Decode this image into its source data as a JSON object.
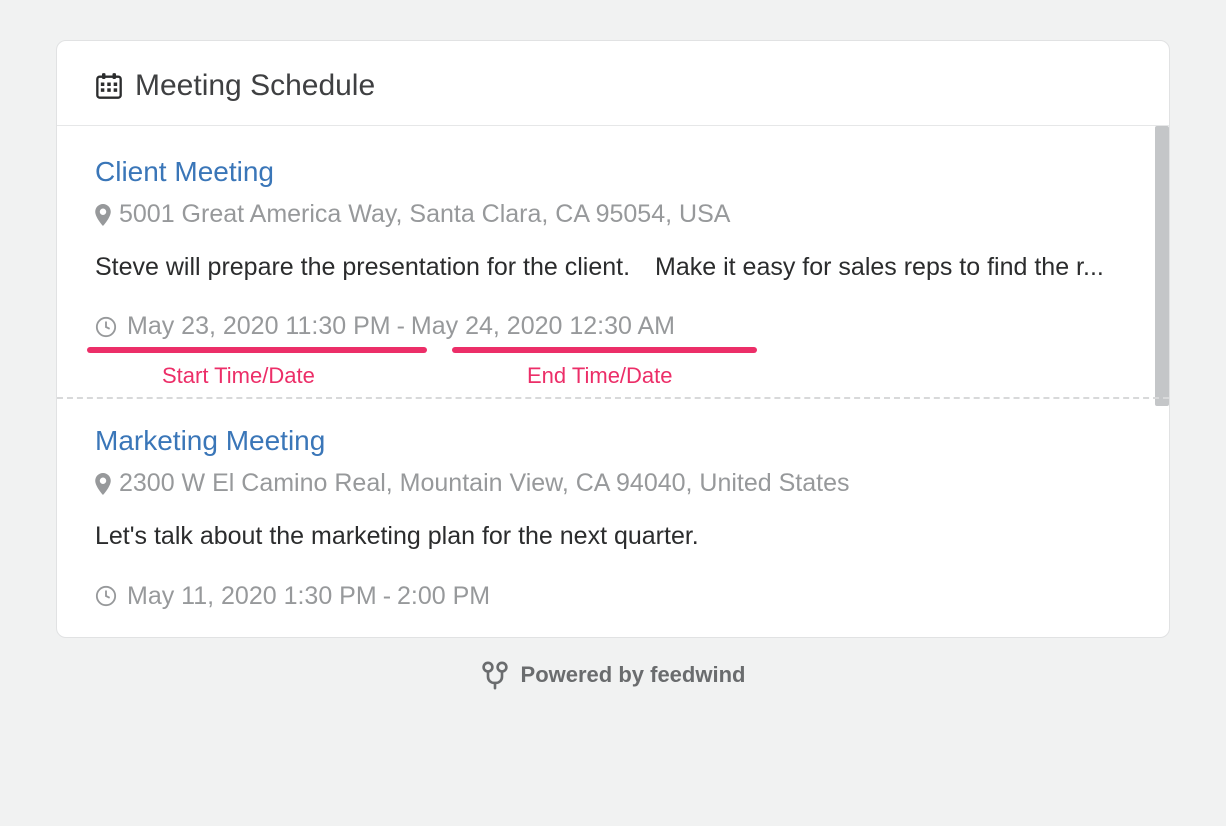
{
  "header": {
    "title": "Meeting Schedule"
  },
  "events": [
    {
      "title": "Client Meeting",
      "location": "5001 Great America Way, Santa Clara, CA 95054, USA",
      "description": "Steve will prepare the presentation for the client. Make it easy for sales reps to find the r...",
      "start": "May 23, 2020 11:30 PM",
      "separator": " - ",
      "end": "May 24, 2020 12:30 AM"
    },
    {
      "title": "Marketing Meeting",
      "location": "2300 W El Camino Real, Mountain View, CA 94040, United States",
      "description": "Let's talk about the marketing plan for the next quarter.",
      "start": "May 11, 2020 1:30 PM",
      "separator": " - ",
      "end": "2:00 PM"
    }
  ],
  "annotations": {
    "start_label": "Start Time/Date",
    "end_label": "End Time/Date"
  },
  "footer": {
    "text": "Powered by feedwind"
  }
}
